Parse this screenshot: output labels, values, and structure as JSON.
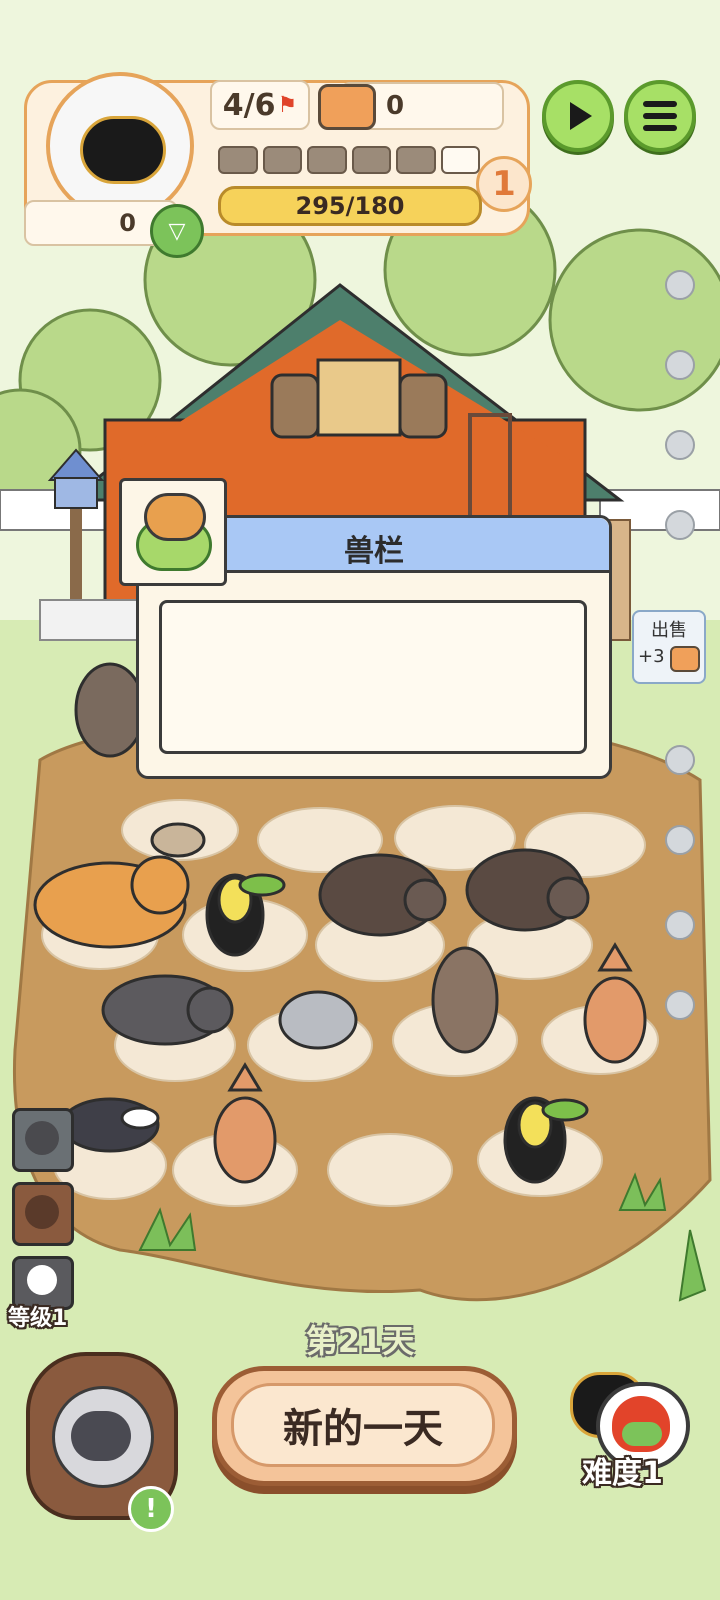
{
  "hud": {
    "flag_count": "4/6",
    "can_count": "0",
    "coin_count": "0",
    "progress_text": "295/180",
    "level_badge": "1",
    "progress_segments": 6,
    "progress_filled": 5,
    "buttons": {
      "play_icon": "play-icon",
      "menu_icon": "list-menu-icon"
    }
  },
  "dialog": {
    "title": "兽栏",
    "icon": "fox-bowl-icon"
  },
  "sell": {
    "label": "出售",
    "reward": "+3",
    "icon": "can-icon"
  },
  "side_buttons": [
    {
      "name": "animal-icon-1"
    },
    {
      "name": "animal-icon-2"
    },
    {
      "name": "level",
      "label": "等级1"
    }
  ],
  "day": {
    "label": "第21天",
    "button_label": "新的一天"
  },
  "difficulty": {
    "label": "难度1"
  },
  "colors": {
    "accent_orange": "#e6a45a",
    "green_button": "#a7e066",
    "dialog_header": "#a9c8f5",
    "ground": "#c89a5e"
  }
}
